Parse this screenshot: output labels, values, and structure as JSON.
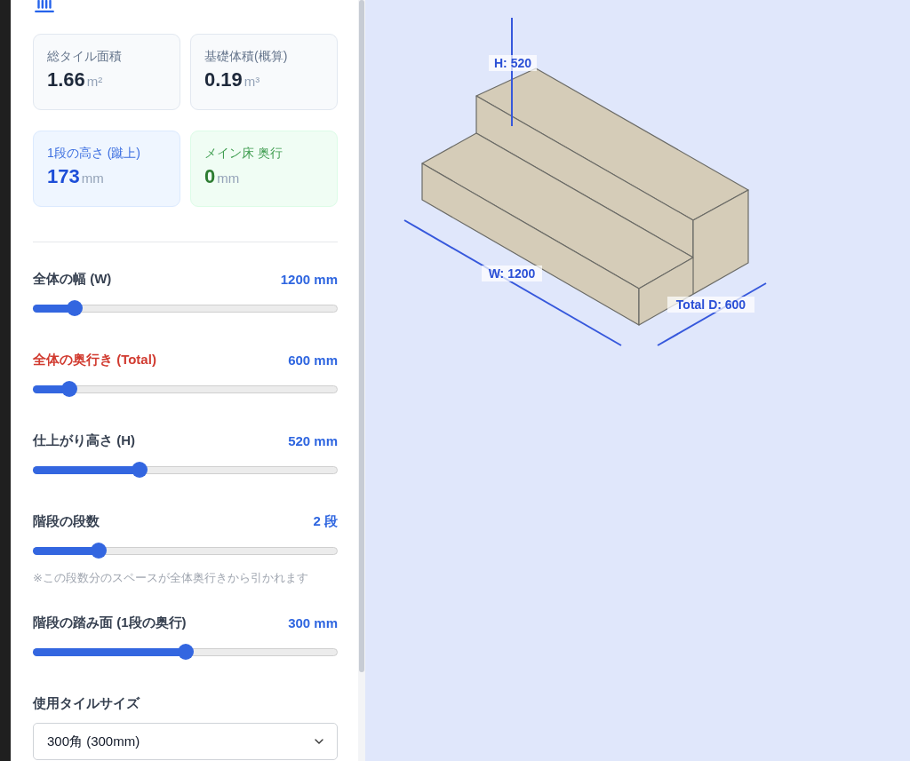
{
  "stats": [
    {
      "label": "総タイル面積",
      "value": "1.66",
      "unit": "m²",
      "kind": "plain"
    },
    {
      "label": "基礎体積(概算)",
      "value": "0.19",
      "unit": "m³",
      "kind": "plain"
    },
    {
      "label": "1段の高さ (蹴上)",
      "value": "173",
      "unit": "mm",
      "kind": "highlight"
    },
    {
      "label": "メイン床 奥行",
      "value": "0",
      "unit": "mm",
      "kind": "positive"
    }
  ],
  "controls": [
    {
      "label": "全体の幅 (W)",
      "reading": "1200 mm",
      "level": 0.137,
      "warning": false
    },
    {
      "label": "全体の奥行き (Total)",
      "reading": "600 mm",
      "level": 0.12,
      "warning": true
    },
    {
      "label": "仕上がり高さ (H)",
      "reading": "520 mm",
      "level": 0.35,
      "warning": false
    },
    {
      "label": "階段の段数",
      "reading": "2 段",
      "level": 0.215,
      "warning": false,
      "note": "※この段数分のスペースが全体奥行きから引かれます"
    },
    {
      "label": "階段の踏み面 (1段の奥行)",
      "reading": "300 mm",
      "level": 0.5,
      "warning": false
    }
  ],
  "tile_size": {
    "label": "使用タイルサイズ",
    "value": "300角 (300mm)"
  },
  "preview": {
    "height_label": "H: 520",
    "width_label": "W: 1200",
    "depth_label": "Total D: 600"
  }
}
